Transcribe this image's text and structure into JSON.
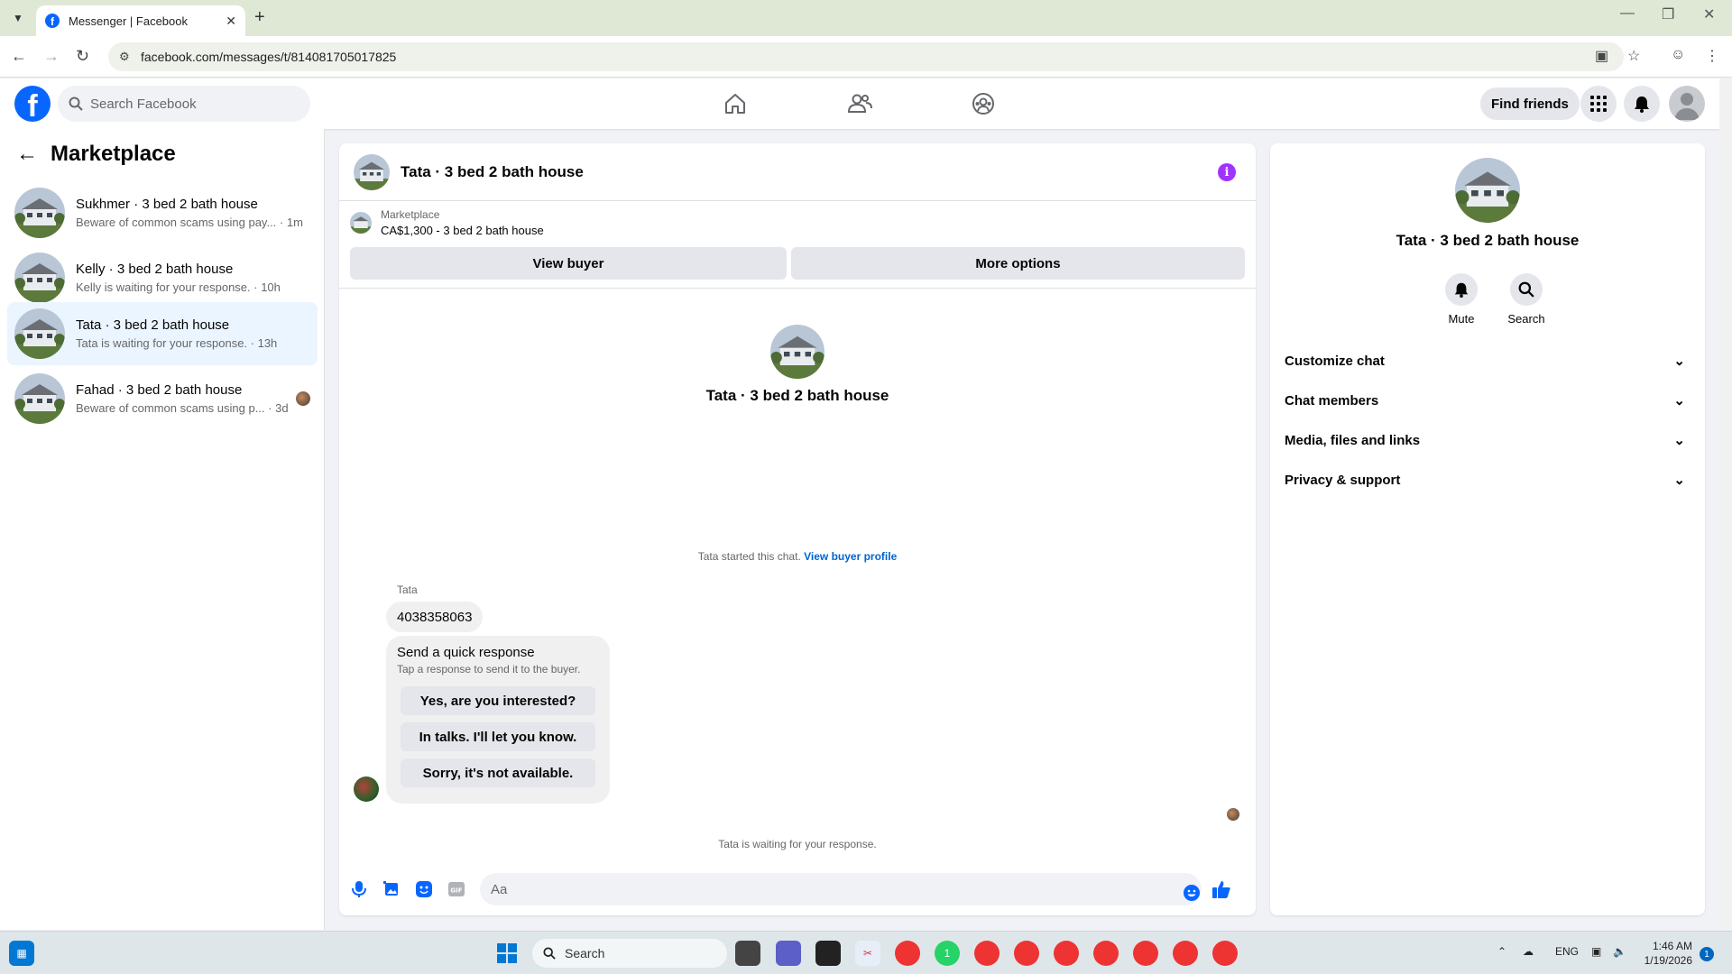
{
  "browser": {
    "tab_title": "Messenger | Facebook",
    "url": "facebook.com/messages/t/814081705017825"
  },
  "fb": {
    "search_placeholder": "Search Facebook",
    "find_friends": "Find friends"
  },
  "sidebar": {
    "title": "Marketplace",
    "conversations": [
      {
        "name": "Sukhmer · 3 bed 2 bath house",
        "snippet": "Beware of common scams using pay... · 1m"
      },
      {
        "name": "Kelly · 3 bed 2 bath house",
        "snippet": "Kelly is waiting for your response. · 10h"
      },
      {
        "name": "Tata · 3 bed 2 bath house",
        "snippet": "Tata is waiting for your response. · 13h"
      },
      {
        "name": "Fahad · 3 bed 2 bath house",
        "snippet": "Beware of common scams using p... · 3d"
      }
    ]
  },
  "chat": {
    "title": "Tata · 3 bed 2 bath house",
    "listing_label": "Marketplace",
    "listing_price": "CA$1,300 - 3 bed 2 bath house",
    "view_buyer": "View buyer",
    "more_options": "More options",
    "center_title": "Tata · 3 bed 2 bath house",
    "started_text": "Tata started this chat.",
    "view_buyer_profile": "View buyer profile",
    "sender": "Tata",
    "message": "4038358063",
    "quick_title": "Send a quick response",
    "quick_subtitle": "Tap a response to send it to the buyer.",
    "quick_options": [
      "Yes, are you interested?",
      "In talks. I'll let you know.",
      "Sorry, it's not available."
    ],
    "waiting": "Tata is waiting for your response.",
    "composer_placeholder": "Aa"
  },
  "details": {
    "title": "Tata · 3 bed 2 bath house",
    "mute": "Mute",
    "search": "Search",
    "sections": [
      "Customize chat",
      "Chat members",
      "Media, files and links",
      "Privacy & support"
    ]
  },
  "taskbar": {
    "search": "Search",
    "lang": "ENG",
    "time": "1:46 AM",
    "date": "1/19/2026",
    "notifications": "1",
    "whatsapp_badge": "1"
  },
  "colors": {
    "fb_blue": "#0866ff",
    "active_conv": "#ebf5ff",
    "info_purple": "#a033ff",
    "link_blue": "#0064d1"
  }
}
